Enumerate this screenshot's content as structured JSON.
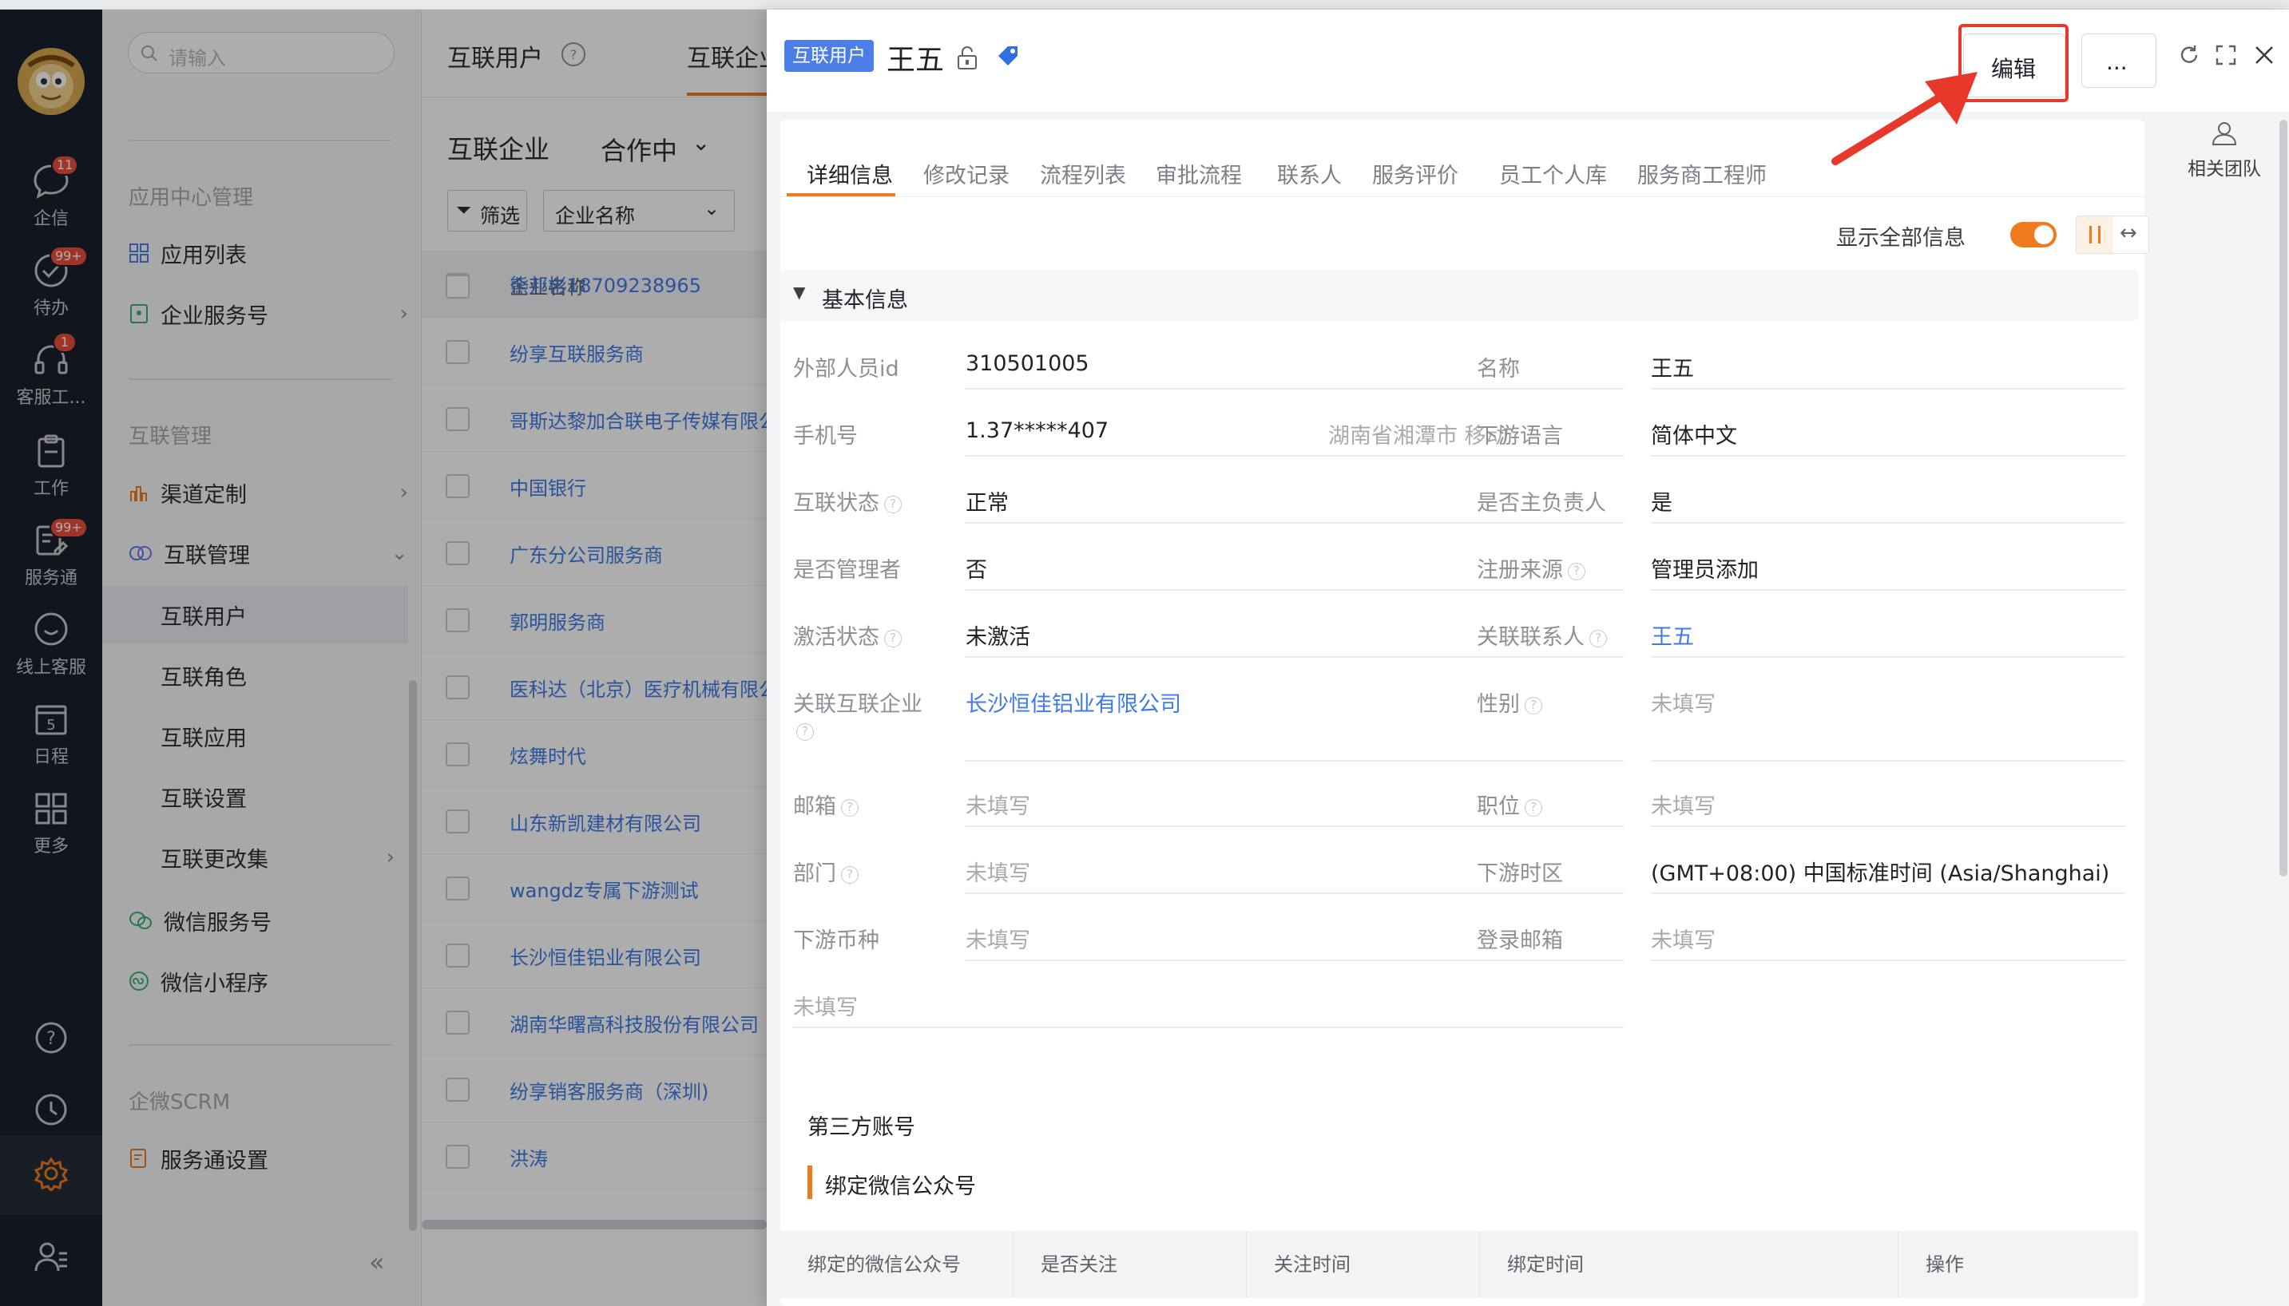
{
  "rail": {
    "items": [
      {
        "label": "企信",
        "badge": "11",
        "icon": "chat-icon"
      },
      {
        "label": "待办",
        "badge": "99+",
        "icon": "check-circle-icon"
      },
      {
        "label": "客服工...",
        "badge": "1",
        "icon": "headset-icon"
      },
      {
        "label": "工作",
        "badge": "",
        "icon": "clipboard-icon"
      },
      {
        "label": "服务通",
        "badge": "99+",
        "icon": "service-edit-icon"
      },
      {
        "label": "线上客服",
        "badge": "",
        "icon": "smile-chat-icon"
      },
      {
        "label": "日程",
        "badge": "",
        "icon": "calendar-icon",
        "day": "5"
      },
      {
        "label": "更多",
        "badge": "",
        "icon": "grid-icon"
      }
    ]
  },
  "sidebar": {
    "search_placeholder": "请输入",
    "section_app_center": "应用中心管理",
    "app_list": "应用列表",
    "enterprise_service_no": "企业服务号",
    "section_interconnect": "互联管理",
    "channel_custom": "渠道定制",
    "interconnect_manage": "互联管理",
    "sub_items": [
      "互联用户",
      "互联角色",
      "互联应用",
      "互联设置",
      "互联更改集"
    ],
    "wechat_service": "微信服务号",
    "wechat_mini": "微信小程序",
    "section_scrm": "企微SCRM",
    "service_settings": "服务通设置",
    "collapse_icon": "«"
  },
  "list": {
    "header_tab1": "互联用户",
    "header_tab2": "互联企业",
    "title": "互联企业",
    "status_filter": "合作中",
    "filter_btn": "筛选",
    "filter_field": "企业名称",
    "col_header": "企业名称",
    "rows": [
      "熊邦彬18709238965",
      "纷享互联服务商",
      "哥斯达黎加合联电子传媒有限公司",
      "中国银行",
      "广东分公司服务商",
      "郭明服务商",
      "医科达（北京）医疗机械有限公司",
      "炫舞时代",
      "山东新凯建材有限公司",
      "wangdz专属下游测试",
      "长沙恒佳铝业有限公司",
      "湖南华曙高科技股份有限公司",
      "纷享销客服务商（深圳)",
      "洪涛"
    ]
  },
  "drawer": {
    "tag": "互联用户",
    "name": "王五",
    "edit_btn": "编辑",
    "more_btn": "...",
    "related_team": "相关团队",
    "tabs": [
      "详细信息",
      "修改记录",
      "流程列表",
      "审批流程",
      "联系人",
      "服务评价",
      "员工个人库",
      "服务商工程师"
    ],
    "show_all": "显示全部信息",
    "section_basic": "基本信息",
    "fields_left": [
      {
        "label": "外部人员id",
        "value": "310501005",
        "help": false
      },
      {
        "label": "手机号",
        "value": "1.37*****407",
        "extra": "湖南省湘潭市 移动",
        "help": false
      },
      {
        "label": "互联状态",
        "value": "正常",
        "help": true
      },
      {
        "label": "是否管理者",
        "value": "否",
        "help": false
      },
      {
        "label": "激活状态",
        "value": "未激活",
        "help": true
      },
      {
        "label": "关联互联企业",
        "value": "长沙恒佳铝业有限公司",
        "help": true
      },
      {
        "label": "邮箱",
        "value": "未填写",
        "help": true
      },
      {
        "label": "部门",
        "value": "未填写",
        "help": true
      },
      {
        "label": "下游币种",
        "value": "未填写",
        "help": false
      }
    ],
    "trailing_empty": "未填写",
    "fields_right": [
      {
        "label": "名称",
        "value": "王五",
        "help": false
      },
      {
        "label": "下游语言",
        "value": "简体中文",
        "help": false
      },
      {
        "label": "是否主负责人",
        "value": "是",
        "help": false
      },
      {
        "label": "注册来源",
        "value": "管理员添加",
        "help": true
      },
      {
        "label": "关联联系人",
        "value": "王五",
        "help": true
      },
      {
        "label": "性别",
        "value": "未填写",
        "help": true
      },
      {
        "label": "职位",
        "value": "未填写",
        "help": true
      },
      {
        "label": "下游时区",
        "value": "(GMT+08:00) 中国标准时间 (Asia/Shanghai)",
        "help": false
      },
      {
        "label": "登录邮箱",
        "value": "未填写",
        "help": false
      }
    ],
    "third_party": "第三方账号",
    "bind_wechat": "绑定微信公众号",
    "table_headers": [
      "绑定的微信公众号",
      "是否关注",
      "关注时间",
      "绑定时间",
      "操作"
    ]
  },
  "colors": {
    "accent": "#3e7be6",
    "annotation": "#e8382c",
    "toggle": "#f07b1e"
  }
}
